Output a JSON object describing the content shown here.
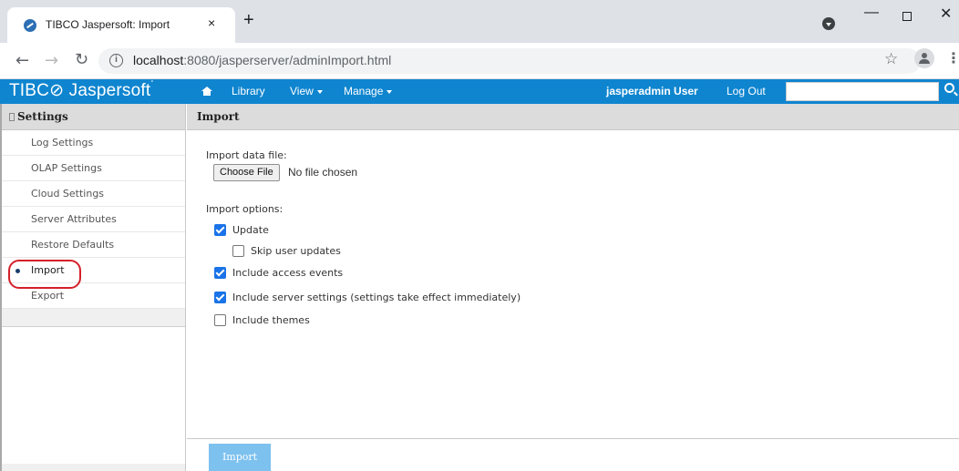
{
  "browser": {
    "tab_title": "TIBCO Jaspersoft: Import",
    "tab_close": "×",
    "new_tab": "+",
    "url_host": "localhost",
    "url_rest": ":8080/jasperserver/adminImport.html",
    "window_min": "—",
    "window_close": "✕"
  },
  "header": {
    "logo": "TIBC⊘ Jaspersoft",
    "nav": [
      "Library",
      "View",
      "Manage"
    ],
    "user": "jasperadmin User",
    "logout": "Log Out",
    "search_placeholder": ""
  },
  "sidebar": {
    "title": "Settings",
    "items": [
      {
        "label": "Log Settings",
        "active": false
      },
      {
        "label": "OLAP Settings",
        "active": false
      },
      {
        "label": "Cloud Settings",
        "active": false
      },
      {
        "label": "Server Attributes",
        "active": false
      },
      {
        "label": "Restore Defaults",
        "active": false
      },
      {
        "label": "Import",
        "active": true
      },
      {
        "label": "Export",
        "active": false
      }
    ]
  },
  "main": {
    "title": "Import",
    "file_label": "Import data file:",
    "choose_file": "Choose File",
    "no_file": "No file chosen",
    "options_label": "Import options:",
    "options": [
      {
        "label": "Update",
        "checked": true
      },
      {
        "label": "Skip user updates",
        "checked": false
      },
      {
        "label": "Include access events",
        "checked": true
      },
      {
        "label": "Include server settings (settings take effect immediately)",
        "checked": true
      },
      {
        "label": "Include themes",
        "checked": false
      }
    ],
    "import_button": "Import"
  },
  "colors": {
    "header_blue": "#0f85cf",
    "import_button": "#7dc1ef",
    "highlight_ring": "#d4202a",
    "checkbox_on": "#1a73e8"
  }
}
